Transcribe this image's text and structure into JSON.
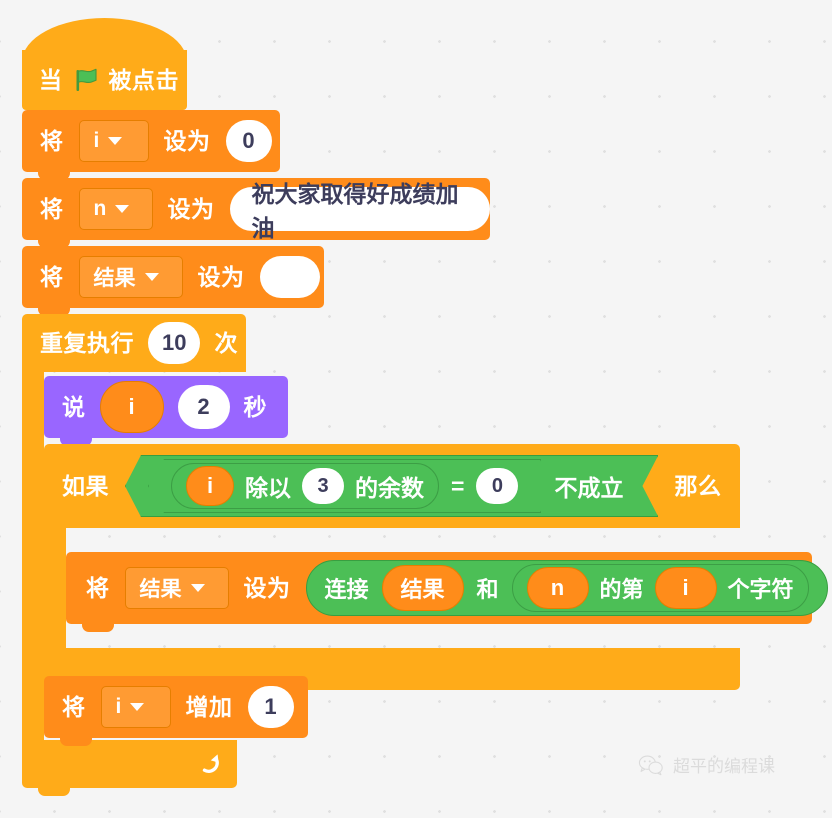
{
  "canvas": {
    "background_color": "#f5f5f5",
    "grid_dot_color": "#e0e0e0"
  },
  "palette": {
    "events": "#ffab19",
    "data": "#ff8c1a",
    "looks": "#9966ff",
    "control": "#ffab19",
    "operators": "#4cbf56",
    "input_white": "#ffffff",
    "input_text": "#3d3d5c"
  },
  "script": {
    "hat": {
      "prefix": "当",
      "icon": "green-flag-icon",
      "suffix": "被点击"
    },
    "set_i": {
      "verb": "将",
      "variable": "i",
      "to_label": "设为",
      "value": "0"
    },
    "set_n": {
      "verb": "将",
      "variable": "n",
      "to_label": "设为",
      "value": "祝大家取得好成绩加油"
    },
    "set_result": {
      "verb": "将",
      "variable": "结果",
      "to_label": "设为",
      "value": ""
    },
    "repeat": {
      "prefix": "重复执行",
      "times": "10",
      "suffix": "次"
    },
    "say": {
      "verb": "说",
      "message_var": "i",
      "seconds": "2",
      "unit": "秒"
    },
    "if_block": {
      "if_label": "如果",
      "then_label": "那么",
      "not_label": "不成立",
      "equals_label": "=",
      "equals_value": "0",
      "mod": {
        "left_var": "i",
        "mid_label": "除以",
        "divisor": "3",
        "right_label": "的余数"
      }
    },
    "set_result_join": {
      "verb": "将",
      "variable": "结果",
      "to_label": "设为",
      "join_label": "连接",
      "first_var": "结果",
      "and_label": "和",
      "letter_of": {
        "string_var": "n",
        "mid_label": "的第",
        "index_var": "i",
        "suffix_label": "个字符"
      }
    },
    "change_i": {
      "verb": "将",
      "variable": "i",
      "change_label": "增加",
      "value": "1"
    }
  },
  "watermark": {
    "icon": "wechat-icon",
    "text": "超平的编程课"
  }
}
